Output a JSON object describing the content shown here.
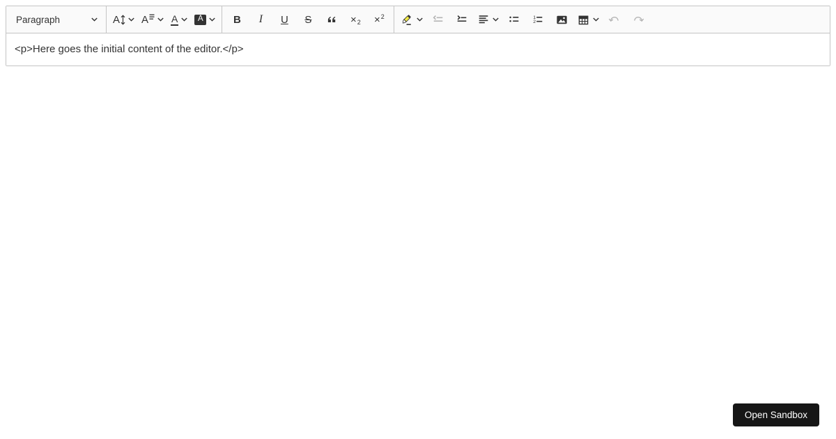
{
  "editor": {
    "heading_dropdown": {
      "label": "Paragraph"
    },
    "toolbar_groups": [
      {
        "items": [
          {
            "name": "font-size",
            "type": "dropdown"
          },
          {
            "name": "font-family",
            "type": "dropdown"
          },
          {
            "name": "font-color",
            "type": "dropdown"
          },
          {
            "name": "font-background-color",
            "type": "dropdown"
          }
        ]
      },
      {
        "items": [
          {
            "name": "bold"
          },
          {
            "name": "italic"
          },
          {
            "name": "underline"
          },
          {
            "name": "strikethrough"
          },
          {
            "name": "block-quote"
          },
          {
            "name": "subscript"
          },
          {
            "name": "superscript"
          }
        ]
      },
      {
        "items": [
          {
            "name": "highlight",
            "type": "dropdown"
          },
          {
            "name": "outdent",
            "disabled": true
          },
          {
            "name": "indent"
          },
          {
            "name": "text-alignment",
            "type": "dropdown"
          },
          {
            "name": "bulleted-list"
          },
          {
            "name": "numbered-list"
          },
          {
            "name": "insert-image"
          },
          {
            "name": "insert-table",
            "type": "dropdown"
          },
          {
            "name": "undo",
            "disabled": true
          },
          {
            "name": "redo",
            "disabled": true
          }
        ]
      }
    ],
    "content_text": "<p>Here goes the initial content of the editor.</p>"
  },
  "sandbox": {
    "open_button_label": "Open Sandbox"
  },
  "colors": {
    "toolbar_background": "#fafafa",
    "border": "#c4c4c4",
    "icon": "#333333",
    "icon_disabled": "#b4b4b4",
    "highlight_pen_yellow": "#f1e843",
    "sandbox_button_background": "#161616",
    "sandbox_button_text": "#ffffff"
  }
}
